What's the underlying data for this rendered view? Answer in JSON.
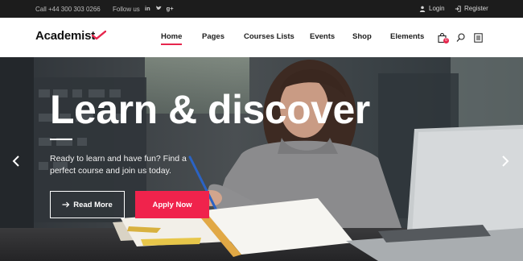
{
  "topbar": {
    "phone": "Call +44 300 303 0266",
    "follow_label": "Follow us",
    "social": [
      {
        "label": "in",
        "icon": "linkedin-icon"
      },
      {
        "label": "t",
        "icon": "twitter-icon"
      },
      {
        "label": "g+",
        "icon": "google-plus-icon"
      }
    ],
    "login_label": "Login",
    "register_label": "Register"
  },
  "header": {
    "logo": "Academist",
    "nav": [
      {
        "label": "Home",
        "active": true
      },
      {
        "label": "Pages",
        "active": false
      },
      {
        "label": "Courses Lists",
        "active": false
      },
      {
        "label": "Events",
        "active": false
      },
      {
        "label": "Shop",
        "active": false
      },
      {
        "label": "Elements",
        "active": false
      }
    ],
    "cart_count": "0"
  },
  "hero": {
    "title": "Learn & discover",
    "text": "Ready to learn and have fun? Find a perfect course and join us today.",
    "primary_button": "Read More",
    "secondary_button": "Apply Now"
  },
  "colors": {
    "accent": "#f0234c",
    "topbar_bg": "#1c1c1c"
  }
}
